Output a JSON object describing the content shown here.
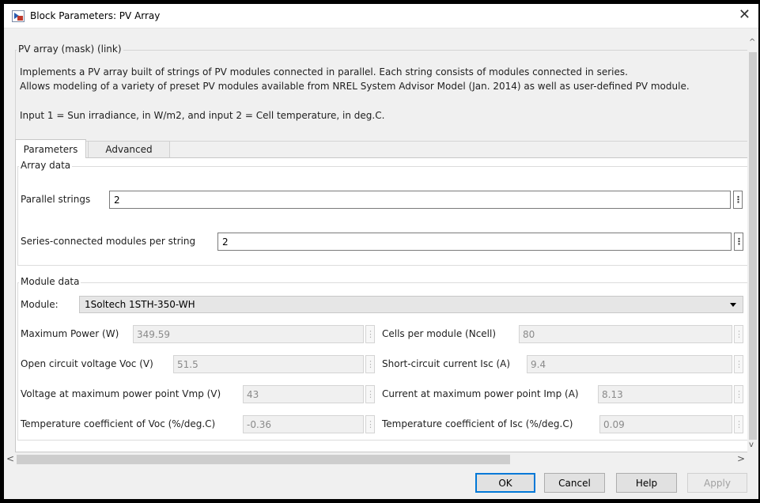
{
  "window": {
    "title": "Block Parameters: PV Array",
    "close_glyph": "✕"
  },
  "mask": {
    "title": "PV array (mask) (link)",
    "description_line1": "Implements a PV array built of strings of PV modules connected in parallel. Each string consists of modules connected in series.",
    "description_line2": "Allows modeling of a variety of preset PV modules available from NREL System Advisor Model (Jan. 2014) as well as user-defined PV module.",
    "description_line3": "Input 1 = Sun irradiance, in W/m2, and input 2 = Cell temperature, in deg.C."
  },
  "tabs": [
    {
      "label": "Parameters",
      "active": true
    },
    {
      "label": "Advanced",
      "active": false
    }
  ],
  "array_data": {
    "legend": "Array data",
    "parallel_strings_label": "Parallel strings",
    "parallel_strings_value": "2",
    "series_modules_label": "Series-connected modules per string",
    "series_modules_value": "2",
    "dots_glyph": "⋮"
  },
  "module_data": {
    "legend": "Module data",
    "module_label": "Module:",
    "module_value": "1Soltech 1STH-350-WH",
    "params": [
      {
        "label": "Maximum Power (W)",
        "value": "349.59"
      },
      {
        "label": "Cells per module (Ncell)",
        "value": "80"
      },
      {
        "label": "Open circuit voltage  Voc (V)",
        "value": "51.5"
      },
      {
        "label": "Short-circuit current Isc (A)",
        "value": "9.4"
      },
      {
        "label": "Voltage at maximum power point Vmp (V)",
        "value": "43"
      },
      {
        "label": "Current at maximum power point Imp (A)",
        "value": "8.13"
      },
      {
        "label": "Temperature coefficient of Voc (%/deg.C)",
        "value": "-0.36"
      },
      {
        "label": "Temperature coefficient of Isc (%/deg.C)",
        "value": "0.09"
      }
    ]
  },
  "scrollbars": {
    "up_arrow": "^",
    "down_arrow": "v",
    "left_arrow": "<",
    "right_arrow": ">"
  },
  "buttons": {
    "ok": "OK",
    "cancel": "Cancel",
    "help": "Help",
    "apply": "Apply"
  },
  "colors": {
    "window_bg": "#f0f0f0",
    "ok_accent": "#0078d7"
  }
}
